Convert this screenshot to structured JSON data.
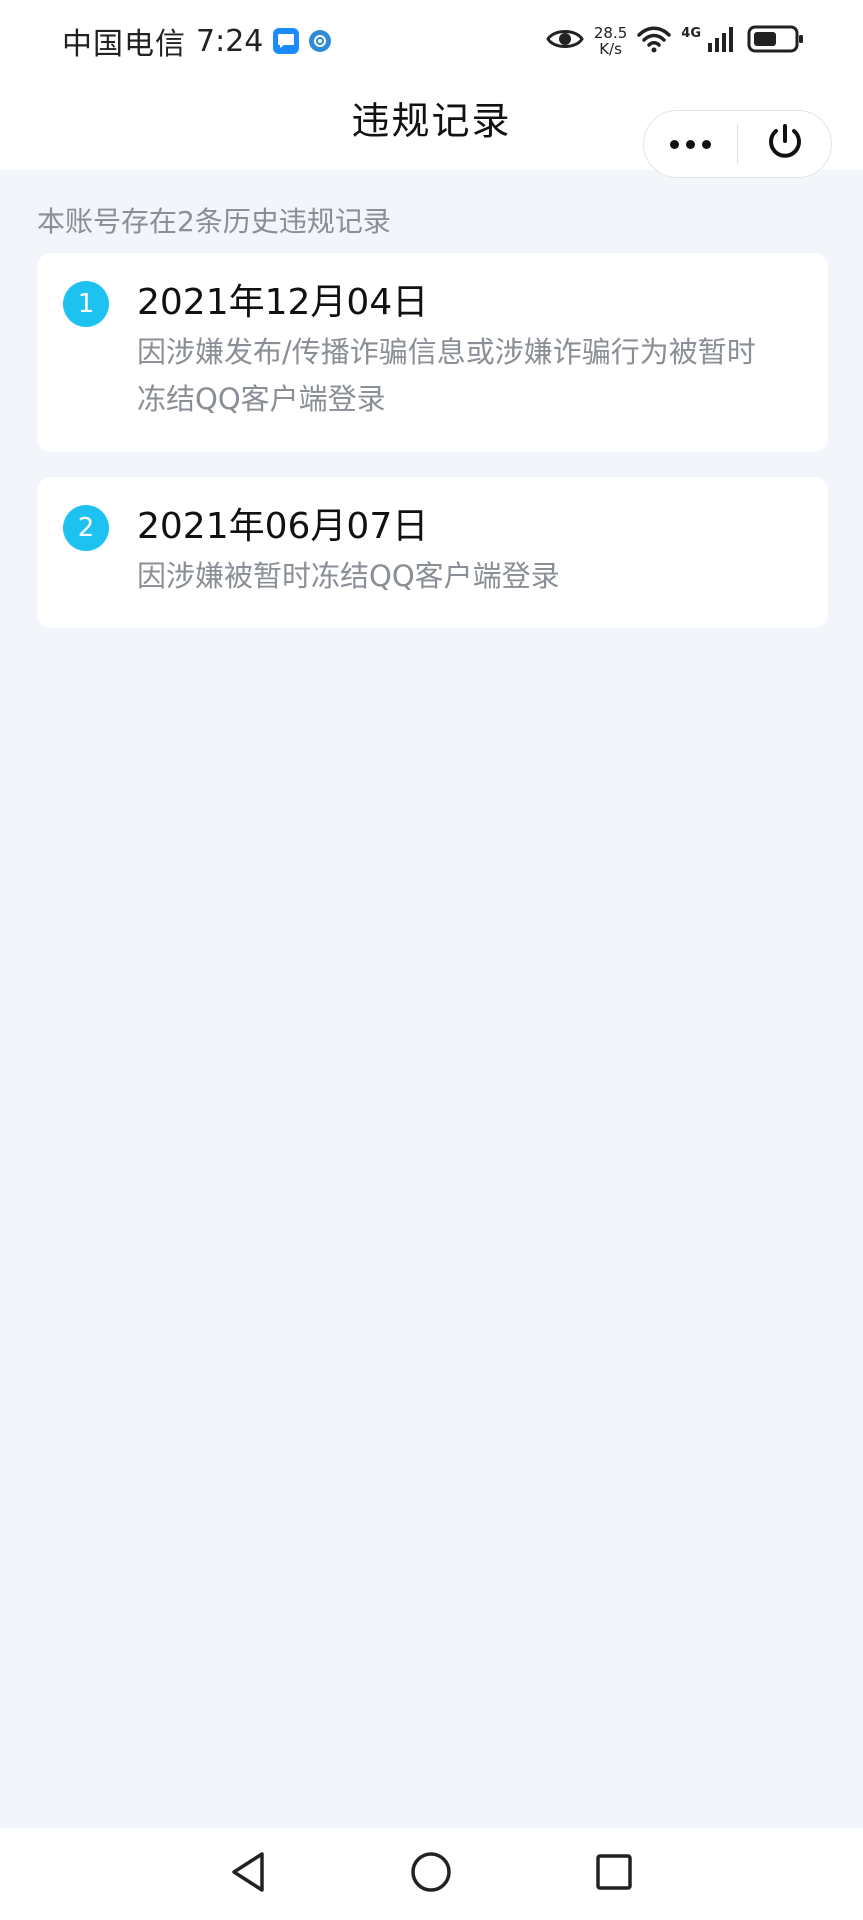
{
  "status_bar": {
    "carrier": "中国电信",
    "time": "7:24",
    "net_speed_value": "28.5",
    "net_speed_unit": "K/s",
    "signal_type": "4G",
    "icons": [
      "message-notification-icon",
      "app-notification-icon",
      "eye-icon",
      "wifi-icon",
      "signal-icon",
      "battery-icon"
    ]
  },
  "header": {
    "title": "违规记录",
    "more_icon": "more-dots-icon",
    "close_icon": "power-icon"
  },
  "summary_text": "本账号存在2条历史违规记录",
  "records": [
    {
      "index": "1",
      "date": "2021年12月04日",
      "reason_line1": "因涉嫌发布/传播诈骗信息或涉嫌诈骗行为被暂时",
      "reason_line2": "冻结QQ客户端登录"
    },
    {
      "index": "2",
      "date": "2021年06月07日",
      "reason_line1": "因涉嫌被暂时冻结QQ客户端登录"
    }
  ],
  "nav_bar": {
    "icons": [
      "back-triangle-icon",
      "home-circle-icon",
      "recents-square-icon"
    ]
  },
  "colors": {
    "accent": "#1ec2f0",
    "background": "#f2f5f9",
    "secondary_text": "#8a8e96"
  }
}
